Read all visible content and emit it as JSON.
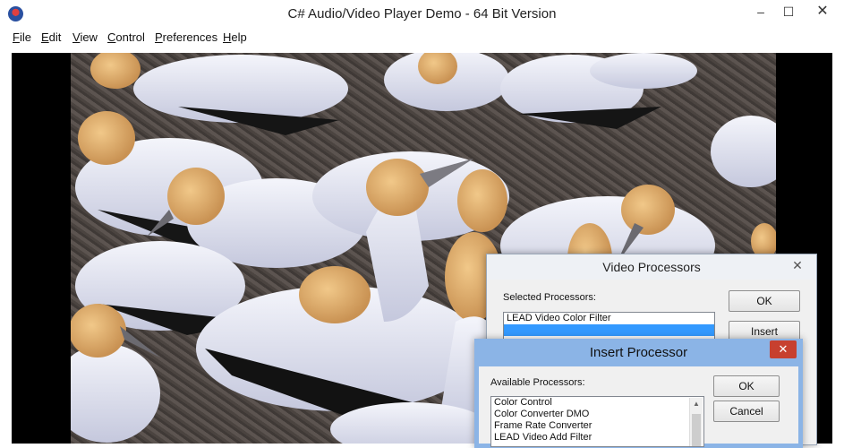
{
  "window": {
    "title": "C# Audio/Video Player Demo - 64 Bit Version",
    "minimize": "–",
    "maximize": "☐",
    "close": "✕"
  },
  "menu": [
    "File",
    "Edit",
    "View",
    "Control",
    "Preferences",
    "Help"
  ],
  "video_processors": {
    "title": "Video Processors",
    "close": "✕",
    "selected_label": "Selected Processors:",
    "selected_items": [
      "LEAD Video Color Filter",
      ""
    ],
    "buttons": {
      "ok": "OK",
      "insert_before": "Insert Before..."
    }
  },
  "insert_processor": {
    "title": "Insert Processor",
    "close": "✕",
    "available_label": "Available Processors:",
    "items": [
      "Color Control",
      "Color Converter DMO",
      "Frame Rate Converter",
      "LEAD Video Add Filter"
    ],
    "buttons": {
      "ok": "OK",
      "cancel": "Cancel"
    }
  },
  "colors": {
    "selection": "#3399ff",
    "active_title": "#8bb4e6",
    "close_red": "#c7402f"
  }
}
